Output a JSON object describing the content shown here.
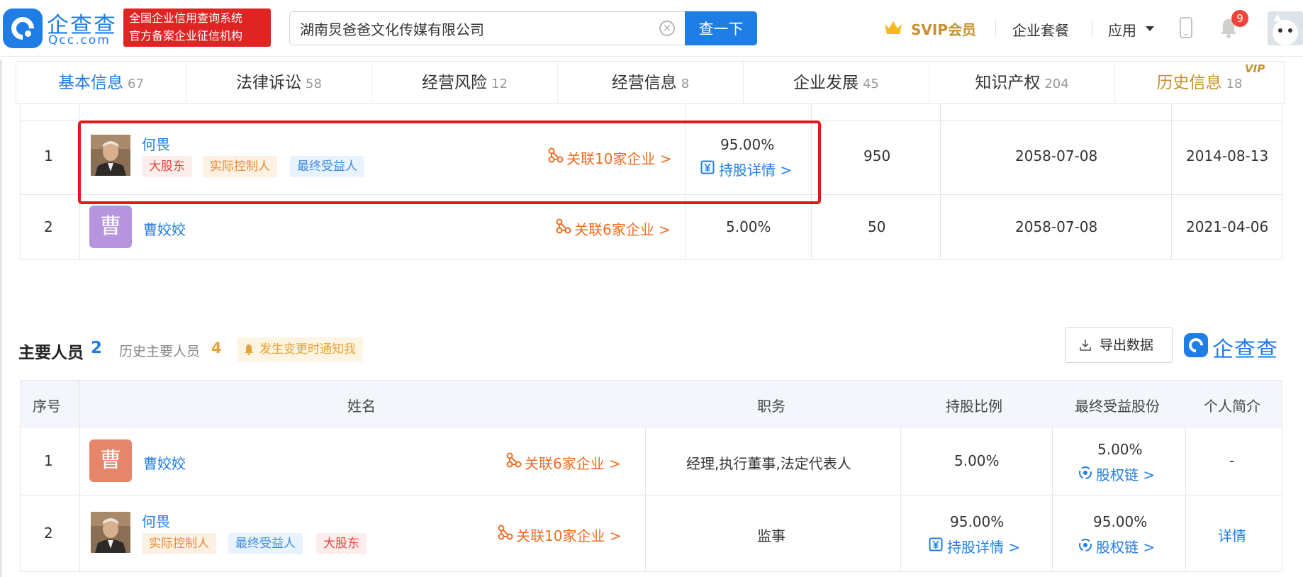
{
  "header": {
    "logo_name": "企查查",
    "logo_domain": "Qcc.com",
    "cert_line1": "全国企业信用查询系统",
    "cert_line2": "官方备案企业征信机构",
    "search_value": "湖南炅爸爸文化传媒有限公司",
    "search_button": "查一下",
    "svip": "SVIP会员",
    "package": "企业套餐",
    "apps": "应用",
    "bell_count": "9"
  },
  "tabs": [
    {
      "label": "基本信息",
      "count": "67"
    },
    {
      "label": "法律诉讼",
      "count": "58"
    },
    {
      "label": "经营风险",
      "count": "12"
    },
    {
      "label": "经营信息",
      "count": "8"
    },
    {
      "label": "企业发展",
      "count": "45"
    },
    {
      "label": "知识产权",
      "count": "204"
    },
    {
      "label": "历史信息",
      "count": "18"
    }
  ],
  "vip_tag": "VIP",
  "shareholders": [
    {
      "index": "1",
      "name": "何畏",
      "tags": [
        "大股东",
        "实际控制人",
        "最终受益人"
      ],
      "related": "关联10家企业 >",
      "ratio": "95.00%",
      "detail": "持股详情 >",
      "amount": "950",
      "due_date": "2058-07-08",
      "start_date": "2014-08-13"
    },
    {
      "index": "2",
      "name": "曹姣姣",
      "avatar_char": "曹",
      "related": "关联6家企业 >",
      "ratio": "5.00%",
      "amount": "50",
      "due_date": "2058-07-08",
      "start_date": "2021-04-06"
    }
  ],
  "personnel": {
    "title": "主要人员",
    "count": "2",
    "history_label": "历史主要人员",
    "history_count": "4",
    "notify": "发生变更时通知我",
    "export": "导出数据",
    "watermark": "企查查",
    "columns": [
      "序号",
      "姓名",
      "职务",
      "持股比例",
      "最终受益股份",
      "个人简介"
    ],
    "rows": [
      {
        "index": "1",
        "name": "曹姣姣",
        "avatar_char": "曹",
        "related": "关联6家企业 >",
        "position": "经理,执行董事,法定代表人",
        "ratio": "5.00%",
        "benefit": "5.00%",
        "chain": "股权链 >",
        "bio": "-"
      },
      {
        "index": "2",
        "name": "何畏",
        "tags": [
          "实际控制人",
          "最终受益人",
          "大股东"
        ],
        "related": "关联10家企业 >",
        "position": "监事",
        "ratio": "95.00%",
        "ratio_detail": "持股详情 >",
        "benefit": "95.00%",
        "chain": "股权链 >",
        "bio": "详情"
      }
    ]
  }
}
